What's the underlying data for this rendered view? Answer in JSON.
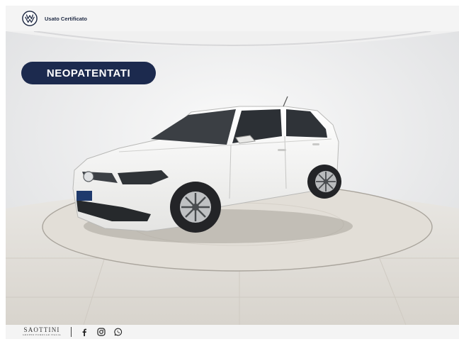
{
  "header": {
    "logo_icon": "vw-logo-icon",
    "title": "Usato Certificato"
  },
  "badge": {
    "label": "NEOPATENTATI"
  },
  "footer": {
    "dealer_name": "SAOTTINI",
    "dealer_sub": "GRUPPO EUROCAR ITALIA",
    "icons": [
      "facebook-icon",
      "instagram-icon",
      "whatsapp-icon"
    ]
  },
  "colors": {
    "badge_bg": "#1c2a4e",
    "bar_bg": "#f4f4f4",
    "car_body": "#f6f6f4"
  }
}
